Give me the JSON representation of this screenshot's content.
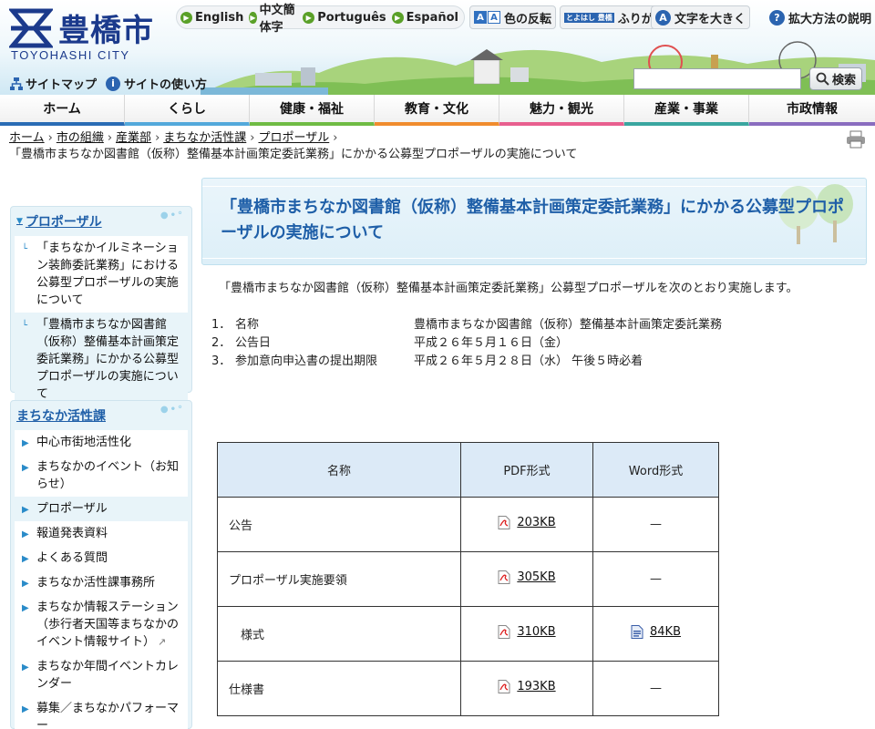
{
  "header": {
    "logo_text": "豊橋市",
    "logo_sub": "TOYOHASHI CITY",
    "languages": [
      "English",
      "中文簡体字",
      "Português",
      "Español"
    ],
    "tools": {
      "invert": "色の反転",
      "furigana_icon": "とよはし 豊橋",
      "furigana": "ふりがな",
      "enlarge": "文字を大きく",
      "help": "拡大方法の説明"
    },
    "util_links": {
      "sitemap": "サイトマップ",
      "howto": "サイトの使い方"
    },
    "search": {
      "placeholder": "",
      "value": "",
      "button": "検索"
    }
  },
  "nav": {
    "items": [
      {
        "label": "ホーム",
        "color": "#2a6cb5"
      },
      {
        "label": "くらし",
        "color": "#53a9db"
      },
      {
        "label": "健康・福祉",
        "color": "#6fbb44"
      },
      {
        "label": "教育・文化",
        "color": "#f08c2e"
      },
      {
        "label": "魅力・観光",
        "color": "#e85f8f"
      },
      {
        "label": "産業・事業",
        "color": "#3aa6a0"
      },
      {
        "label": "市政情報",
        "color": "#8a6dbf"
      }
    ]
  },
  "breadcrumb": {
    "links": [
      "ホーム",
      "市の組織",
      "産業部",
      "まちなか活性課",
      "プロポーザル"
    ],
    "current": "「豊橋市まちなか図書館（仮称）整備基本計画策定委託業務」にかかる公募型プロポーザルの実施について"
  },
  "sidebar": {
    "proposal": {
      "title": "プロポーザル",
      "items": [
        "「まちなかイルミネーション装飾委託業務」における公募型プロポーザルの実施について",
        "「豊橋市まちなか図書館（仮称）整備基本計画策定委託業務」にかかる公募型プロポーザルの実施について"
      ]
    },
    "section": {
      "title": "まちなか活性課",
      "items": [
        "中心市街地活性化",
        "まちなかのイベント（お知らせ）",
        "プロポーザル",
        "報道発表資料",
        "よくある質問",
        "まちなか活性課事務所",
        "まちなか情報ステーション（歩行者天国等まちなかのイベント情報サイト）",
        "まちなか年間イベントカレンダー",
        "募集／まちなかパフォーマー"
      ]
    }
  },
  "main": {
    "title": "「豊橋市まちなか図書館（仮称）整備基本計画策定委託業務」にかかる公募型プロポーザルの実施について",
    "intro": "「豊橋市まちなか図書館（仮称）整備基本計画策定委託業務」公募型プロポーザルを次のとおり実施します。",
    "info": [
      {
        "num": "1．",
        "label": "名称",
        "value": "豊橋市まちなか図書館（仮称）整備基本計画策定委託業務"
      },
      {
        "num": "2．",
        "label": "公告日",
        "value": "平成２６年５月１６日（金）"
      },
      {
        "num": "3．",
        "label": "参加意向申込書の提出期限",
        "value": "平成２６年５月２８日（水） 午後５時必着"
      }
    ],
    "table": {
      "headers": [
        "名称",
        "PDF形式",
        "Word形式"
      ],
      "rows": [
        {
          "name": "公告",
          "pdf": "203KB",
          "word": "—"
        },
        {
          "name": "プロポーザル実施要領",
          "pdf": "305KB",
          "word": "—"
        },
        {
          "name": "　様式",
          "pdf": "310KB",
          "word": "84KB"
        },
        {
          "name": "仕様書",
          "pdf": "193KB",
          "word": "—"
        }
      ]
    }
  }
}
